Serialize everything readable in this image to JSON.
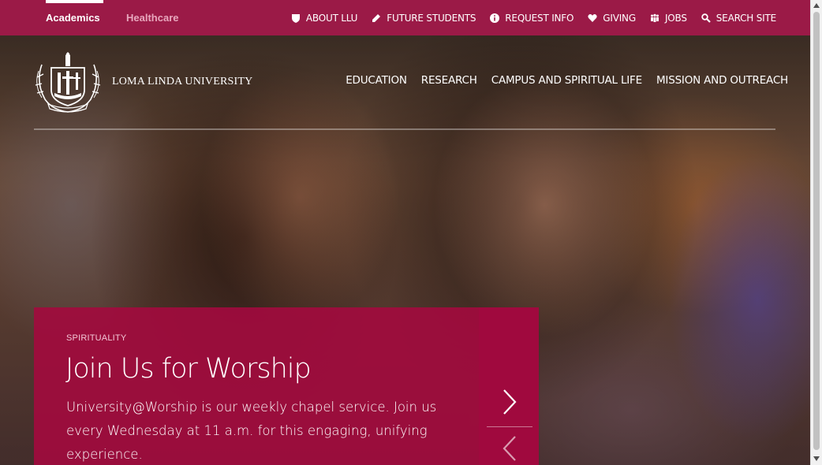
{
  "topbar": {
    "tabs": [
      {
        "label": "Academics",
        "active": true
      },
      {
        "label": "Healthcare",
        "active": false
      }
    ],
    "utility_nav": [
      {
        "label": "ABOUT LLU",
        "icon": "shield-icon"
      },
      {
        "label": "FUTURE STUDENTS",
        "icon": "pencil-icon"
      },
      {
        "label": "REQUEST INFO",
        "icon": "info-icon"
      },
      {
        "label": "GIVING",
        "icon": "heart-icon"
      },
      {
        "label": "JOBS",
        "icon": "people-icon"
      },
      {
        "label": "SEARCH SITE",
        "icon": "search-icon"
      }
    ]
  },
  "header": {
    "logo_text": "LOMA LINDA UNIVERSITY",
    "seal_text": "TO MAKE MAN WHOLE",
    "main_nav": [
      "EDUCATION",
      "RESEARCH",
      "CAMPUS AND SPIRITUAL LIFE",
      "MISSION AND OUTREACH"
    ]
  },
  "feature": {
    "category": "SPIRITUALITY",
    "title": "Join Us for Worship",
    "text": "University@Worship is our weekly chapel service. Join us every Wednesday at 11 a.m. for this engaging, unifying experience."
  },
  "colors": {
    "brand": "#9b1a47",
    "card": "#a30a3e",
    "inactive_tab": "#e8a7bd"
  }
}
